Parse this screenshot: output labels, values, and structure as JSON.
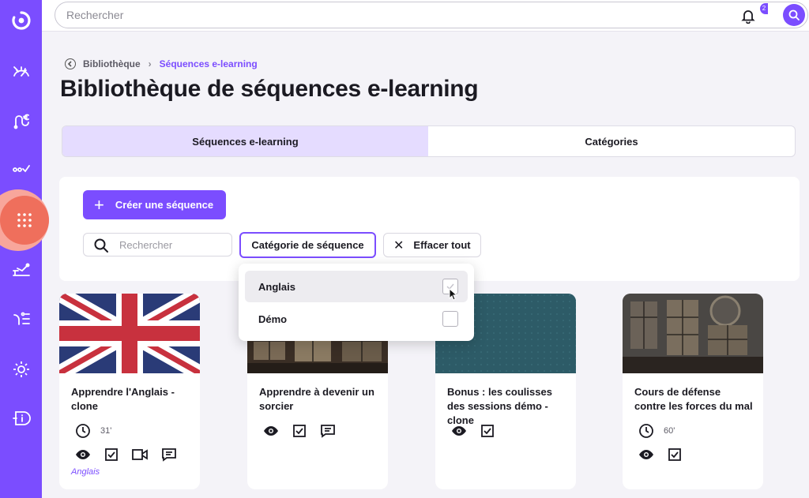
{
  "topbar": {
    "search_placeholder": "Rechercher",
    "notification_badge": "2"
  },
  "sidebar": {
    "items": [
      {
        "icon": "logo-icon"
      },
      {
        "icon": "dashboard-gauge-icon"
      },
      {
        "icon": "finance-euro-icon"
      },
      {
        "icon": "workflow-check-icon"
      },
      {
        "icon": "apps-grid-icon",
        "active": true
      },
      {
        "icon": "analytics-icon"
      },
      {
        "icon": "users-list-icon"
      },
      {
        "icon": "settings-gear-icon"
      },
      {
        "icon": "info-badge-icon"
      }
    ]
  },
  "breadcrumb": {
    "parent": "Bibliothèque",
    "current": "Séquences e-learning"
  },
  "page_title": "Bibliothèque de séquences e-learning",
  "tabs": [
    {
      "label": "Séquences e-learning",
      "active": true
    },
    {
      "label": "Catégories",
      "active": false
    }
  ],
  "filters": {
    "create_label": "Créer une séquence",
    "search_placeholder": "Rechercher",
    "category_label": "Catégorie de séquence",
    "clear_label": "Effacer tout"
  },
  "dropdown": {
    "options": [
      {
        "label": "Anglais",
        "checked": false,
        "hovered": true
      },
      {
        "label": "Démo",
        "checked": false
      }
    ]
  },
  "cards": [
    {
      "title": "Apprendre l'Anglais - clone",
      "duration": "31'",
      "category": "Anglais",
      "icons": [
        "eye-icon",
        "checkbox-icon",
        "video-icon",
        "comment-icon"
      ]
    },
    {
      "title": "Apprendre à devenir un sorcier",
      "duration": "",
      "category": "",
      "icons": [
        "eye-icon",
        "checkbox-icon",
        "comment-icon"
      ]
    },
    {
      "title": "Bonus : les coulisses des sessions démo - clone",
      "duration": "",
      "category": "",
      "icons": [
        "eye-icon",
        "checkbox-icon"
      ]
    },
    {
      "title": "Cours de défense contre les forces du mal",
      "duration": "60'",
      "category": "",
      "icons": [
        "eye-icon",
        "checkbox-icon"
      ]
    }
  ],
  "colors": {
    "brand": "#7b4dff",
    "active_nav": "#ef6f5c",
    "tab_active_bg": "#e5dcff"
  }
}
